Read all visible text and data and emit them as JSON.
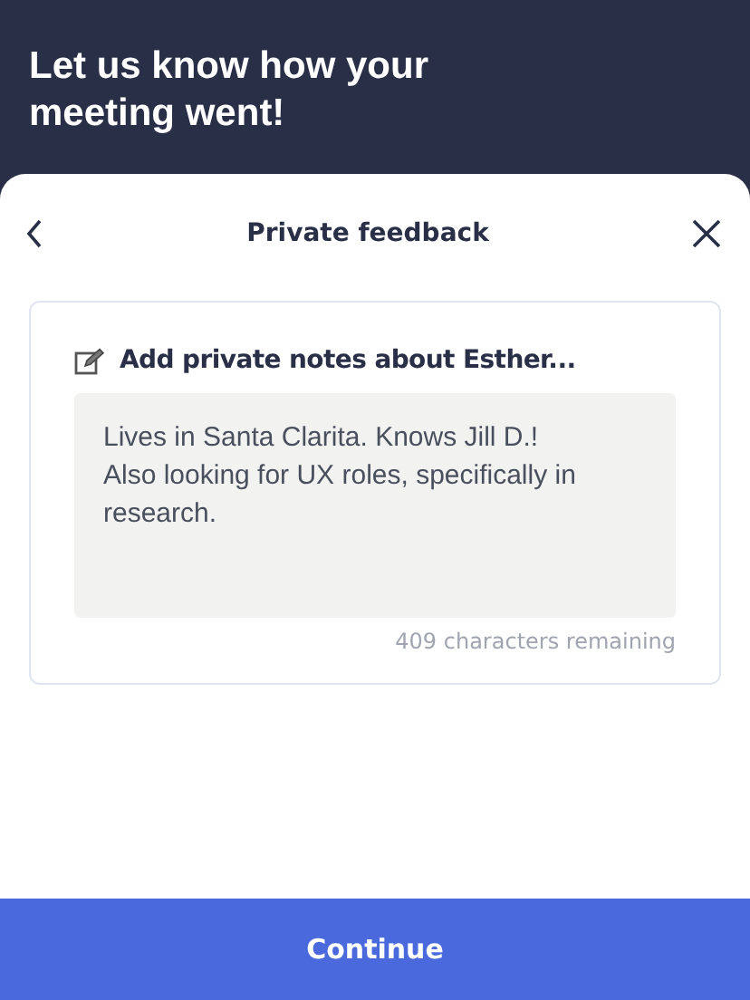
{
  "header": {
    "title": "Let us know how your meeting went!"
  },
  "sheet": {
    "title": "Private feedback",
    "card": {
      "label": "Add private notes about Esther...",
      "notes": "Lives in Santa Clarita. Knows Jill D.!\nAlso looking for UX roles, specifically in research.",
      "counter": "409 characters remaining"
    }
  },
  "buttons": [
    "Continue"
  ]
}
